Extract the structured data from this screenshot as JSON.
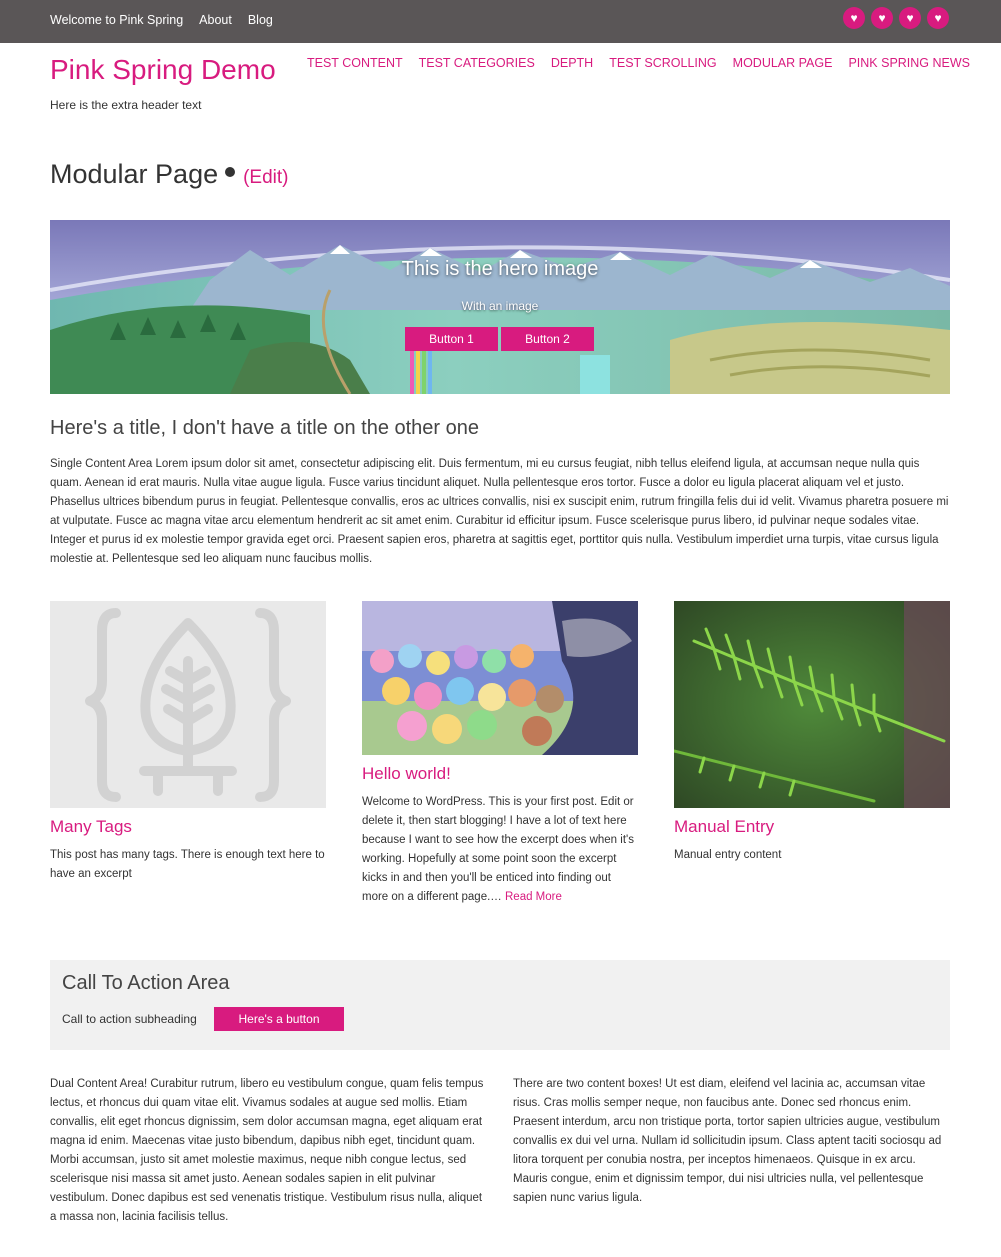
{
  "topbar": {
    "links": [
      "Welcome to Pink Spring",
      "About",
      "Blog"
    ],
    "social_icons": [
      "heart-icon",
      "heart-icon",
      "heart-icon",
      "heart-icon"
    ]
  },
  "header": {
    "site_title": "Pink Spring Demo",
    "tagline": "Here is the extra header text",
    "nav": [
      "TEST CONTENT",
      "TEST CATEGORIES",
      "DEPTH",
      "TEST SCROLLING",
      "MODULAR PAGE",
      "PINK SPRING NEWS"
    ]
  },
  "page": {
    "title": "Modular Page",
    "edit_label": "(Edit)"
  },
  "hero": {
    "title": "This is the hero image",
    "subtitle": "With an image",
    "button1": "Button 1",
    "button2": "Button 2"
  },
  "single": {
    "title": "Here's a title, I don't have a title on the other one",
    "text": "Single Content Area Lorem ipsum dolor sit amet, consectetur adipiscing elit. Duis fermentum, mi eu cursus feugiat, nibh tellus eleifend ligula, at accumsan neque nulla quis quam. Aenean id erat mauris. Nulla vitae augue ligula. Fusce varius tincidunt aliquet. Nulla pellentesque eros tortor. Fusce a dolor eu ligula placerat aliquam vel et justo. Phasellus ultrices bibendum purus in feugiat. Pellentesque convallis, eros ac ultrices convallis, nisi ex suscipit enim, rutrum fringilla felis dui id velit. Vivamus pharetra posuere mi at vulputate. Fusce ac magna vitae arcu elementum hendrerit ac sit amet enim. Curabitur id efficitur ipsum. Fusce scelerisque purus libero, id pulvinar neque sodales vitae. Integer et purus id ex molestie tempor gravida eget orci. Praesent sapien eros, pharetra at sagittis eget, porttitor quis nulla. Vestibulum imperdiet urna turpis, vitae cursus ligula molestie at. Pellentesque sed leo aliquam nunc faucibus mollis."
  },
  "cards": [
    {
      "title": "Many Tags",
      "excerpt": "This post has many tags. There is enough text here to have an excerpt"
    },
    {
      "title": "Hello world!",
      "excerpt": "Welcome to WordPress. This is your first post. Edit or delete it, then start blogging! I have a lot of text here because I want to see how the excerpt does when it's working. Hopefully at some point soon the excerpt kicks in and then you'll be enticed into finding out more on a different page.…",
      "read_more": "Read More"
    },
    {
      "title": "Manual Entry",
      "excerpt": "Manual entry content"
    }
  ],
  "cta": {
    "title": "Call To Action Area",
    "subheading": "Call to action subheading",
    "button": "Here's a button"
  },
  "dual": {
    "left": "Dual Content Area! Curabitur rutrum, libero eu vestibulum congue, quam felis tempus lectus, et rhoncus dui quam vitae elit. Vivamus sodales at augue sed mollis. Etiam convallis, elit eget rhoncus dignissim, sem dolor accumsan magna, eget aliquam erat magna id enim. Maecenas vitae justo bibendum, dapibus nibh eget, tincidunt quam. Morbi accumsan, justo sit amet molestie maximus, neque nibh congue lectus, sed scelerisque nisi massa sit amet justo. Aenean sodales sapien in elit pulvinar vestibulum. Donec dapibus est sed venenatis tristique. Vestibulum risus nulla, aliquet a massa non, lacinia facilisis tellus.",
    "right": "There are two content boxes! Ut est diam, eleifend vel lacinia ac, accumsan vitae risus. Cras mollis semper neque, non faucibus ante. Donec sed rhoncus enim. Praesent interdum, arcu non tristique porta, tortor sapien ultricies augue, vestibulum convallis ex dui vel urna. Nullam id sollicitudin ipsum. Class aptent taciti sociosqu ad litora torquent per conubia nostra, per inceptos himenaeos. Quisque in ex arcu. Mauris congue, enim et dignissim tempor, dui nisi ultricies nulla, vel pellentesque sapien nunc varius ligula."
  },
  "colors": {
    "accent": "#d81b7f",
    "topbar": "#5a5657",
    "cta_bg": "#f1f1f1"
  }
}
